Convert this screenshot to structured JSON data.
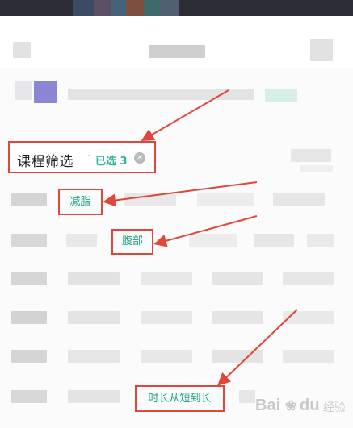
{
  "filter": {
    "title": "课程筛选",
    "separator": "·",
    "selected_text": "已选 3",
    "clear_icon": "×"
  },
  "annotations": {
    "tags": [
      "减脂",
      "腹部",
      "时长从短到长"
    ]
  },
  "watermark": {
    "brand": "Bai",
    "paw_icon": "❀",
    "brand_suffix": "du",
    "sub": "经验"
  },
  "colors": {
    "annotation": "#e0463a",
    "accent": "#2bb59a",
    "tag_text": "#21a184"
  }
}
